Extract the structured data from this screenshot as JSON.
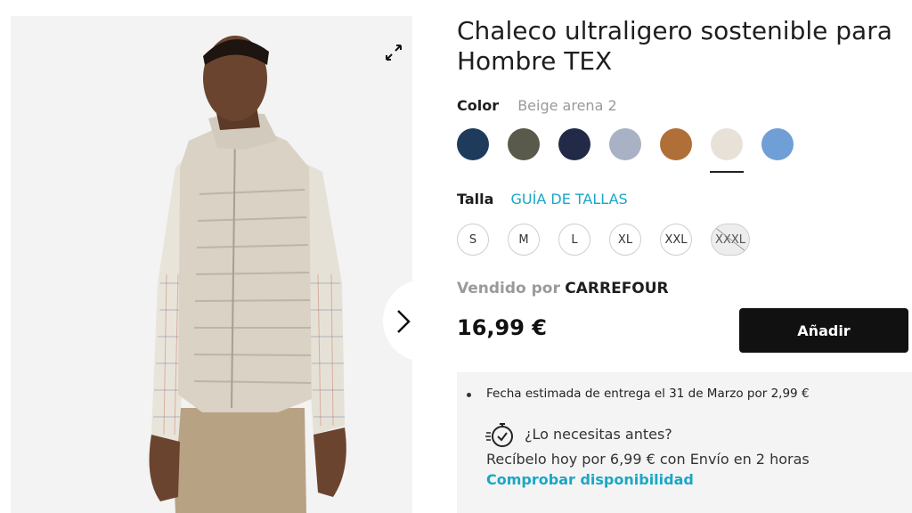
{
  "product": {
    "title": "Chaleco ultraligero sostenible para Hombre TEX",
    "color_label": "Color",
    "color_selected": "Beige arena 2",
    "swatches": [
      {
        "name": "navy-blue",
        "color": "#1f3b5c"
      },
      {
        "name": "olive",
        "color": "#5a5a4c"
      },
      {
        "name": "dark-navy",
        "color": "#222a48"
      },
      {
        "name": "light-grey-blue",
        "color": "#a8b2c4"
      },
      {
        "name": "camel",
        "color": "#b06f36"
      },
      {
        "name": "beige-arena",
        "color": "#e8e1d8"
      },
      {
        "name": "sky-blue",
        "color": "#6f9fd6"
      }
    ],
    "size_label": "Talla",
    "size_guide": "GUÍA DE TALLAS",
    "sizes": [
      "S",
      "M",
      "L",
      "XL",
      "XXL",
      "XXXL"
    ],
    "seller_prefix": "Vendido por",
    "seller_name": "CARREFOUR",
    "price": "16,99 €",
    "add_button": "Añadir"
  },
  "delivery": {
    "estimate": "Fecha estimada de entrega el 31 de Marzo por 2,99 €",
    "need_sooner": "¿Lo necesitas antes?",
    "express": "Recíbelo hoy por 6,99 € con Envío en 2 horas",
    "check_link": "Comprobar disponibilidad"
  },
  "icons": {
    "expand": "expand-icon",
    "next": "chevron-right-icon",
    "timer": "stopwatch-icon"
  },
  "colors": {
    "accent": "#1aa7c5",
    "button": "#111111"
  }
}
